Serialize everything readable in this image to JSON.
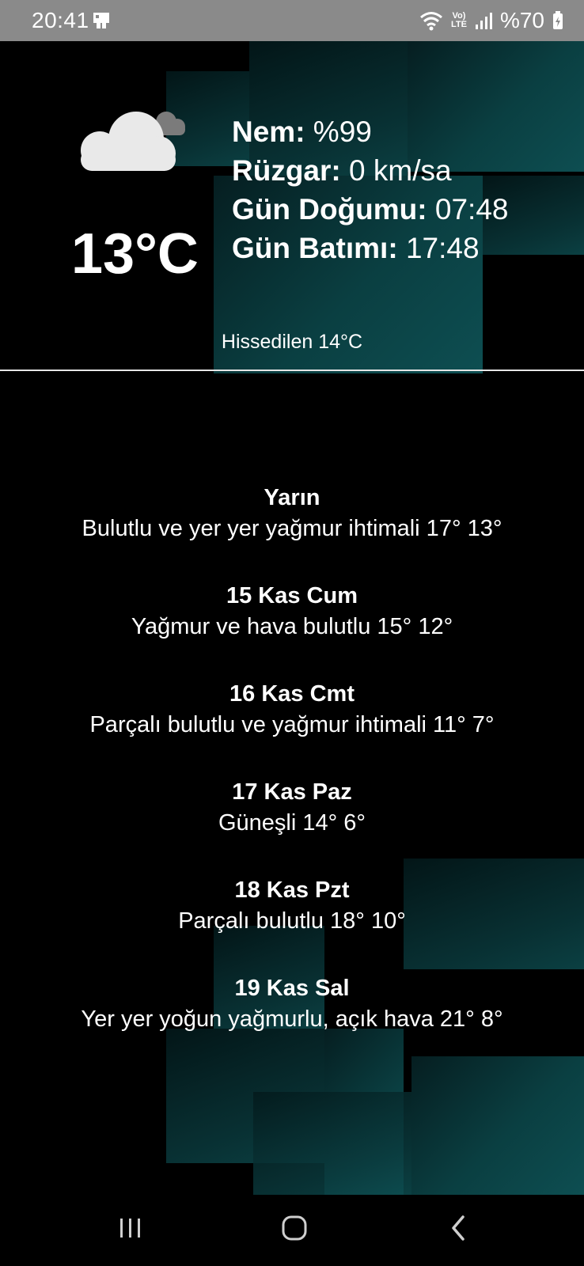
{
  "status_bar": {
    "time": "20:41",
    "battery_text": "%70",
    "network_badge_top": "Vo)",
    "network_badge_bottom": "LTE"
  },
  "current": {
    "icon": "cloud-icon",
    "temperature": "13°C",
    "humidity_label": "Nem:",
    "humidity_value": " %99",
    "wind_label": "Rüzgar:",
    "wind_value": " 0 km/sa",
    "sunrise_label": "Gün Doğumu:",
    "sunrise_value": " 07:48",
    "sunset_label": "Gün Batımı:",
    "sunset_value": " 17:48",
    "feels_like": "Hissedilen 14°C"
  },
  "forecast": [
    {
      "day": "Yarın",
      "desc": "Bulutlu ve yer yer yağmur ihtimali 17° 13°"
    },
    {
      "day": "15 Kas Cum",
      "desc": "Yağmur ve hava bulutlu 15° 12°"
    },
    {
      "day": "16 Kas Cmt",
      "desc": "Parçalı bulutlu ve yağmur ihtimali 11° 7°"
    },
    {
      "day": "17 Kas Paz",
      "desc": "Güneşli 14° 6°"
    },
    {
      "day": "18 Kas Pzt",
      "desc": "Parçalı bulutlu 18° 10°"
    },
    {
      "day": "19 Kas Sal",
      "desc": "Yer yer yoğun yağmurlu, açık hava 21° 8°"
    }
  ],
  "nav": {
    "recents": "recents-icon",
    "home": "home-icon",
    "back": "back-icon"
  },
  "colors": {
    "background": "#000000",
    "status_bar": "#8a8a8a",
    "accent_teal": "#0c4a4d",
    "text": "#ffffff"
  }
}
